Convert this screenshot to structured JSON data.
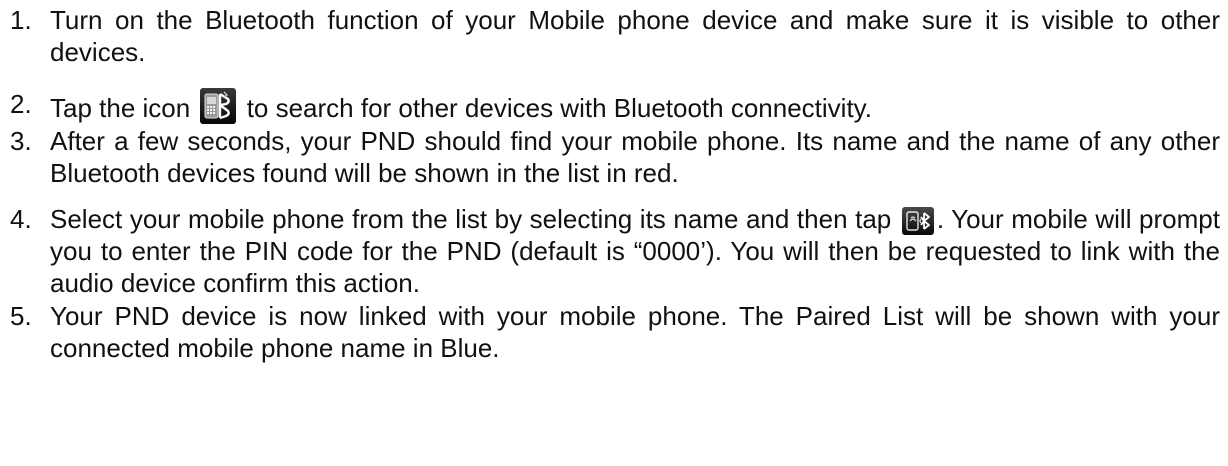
{
  "steps": [
    {
      "number": "1.",
      "text": "Turn on the Bluetooth function of your Mobile phone device and make sure it is visible to other devices."
    },
    {
      "number": "2.",
      "text_before": "Tap the icon",
      "icon": "bluetooth-search-icon",
      "text_after": "to search for other devices with Bluetooth connectivity."
    },
    {
      "number": "3.",
      "text": "After a few seconds, your PND should find your mobile phone. Its name and the name of any other Bluetooth devices found will be shown in the list in red."
    },
    {
      "number": "4.",
      "text_before": "Select your mobile phone from the list by selecting its name and then tap",
      "icon": "bluetooth-pair-icon",
      "text_after": ". Your mobile will prompt you to enter the PIN code for the PND (default is “0000’). You will then be requested to link with the audio device confirm this action."
    },
    {
      "number": "5.",
      "text": "Your PND device is now linked with your mobile phone. The Paired List will be shown with your connected mobile phone name in Blue."
    }
  ]
}
